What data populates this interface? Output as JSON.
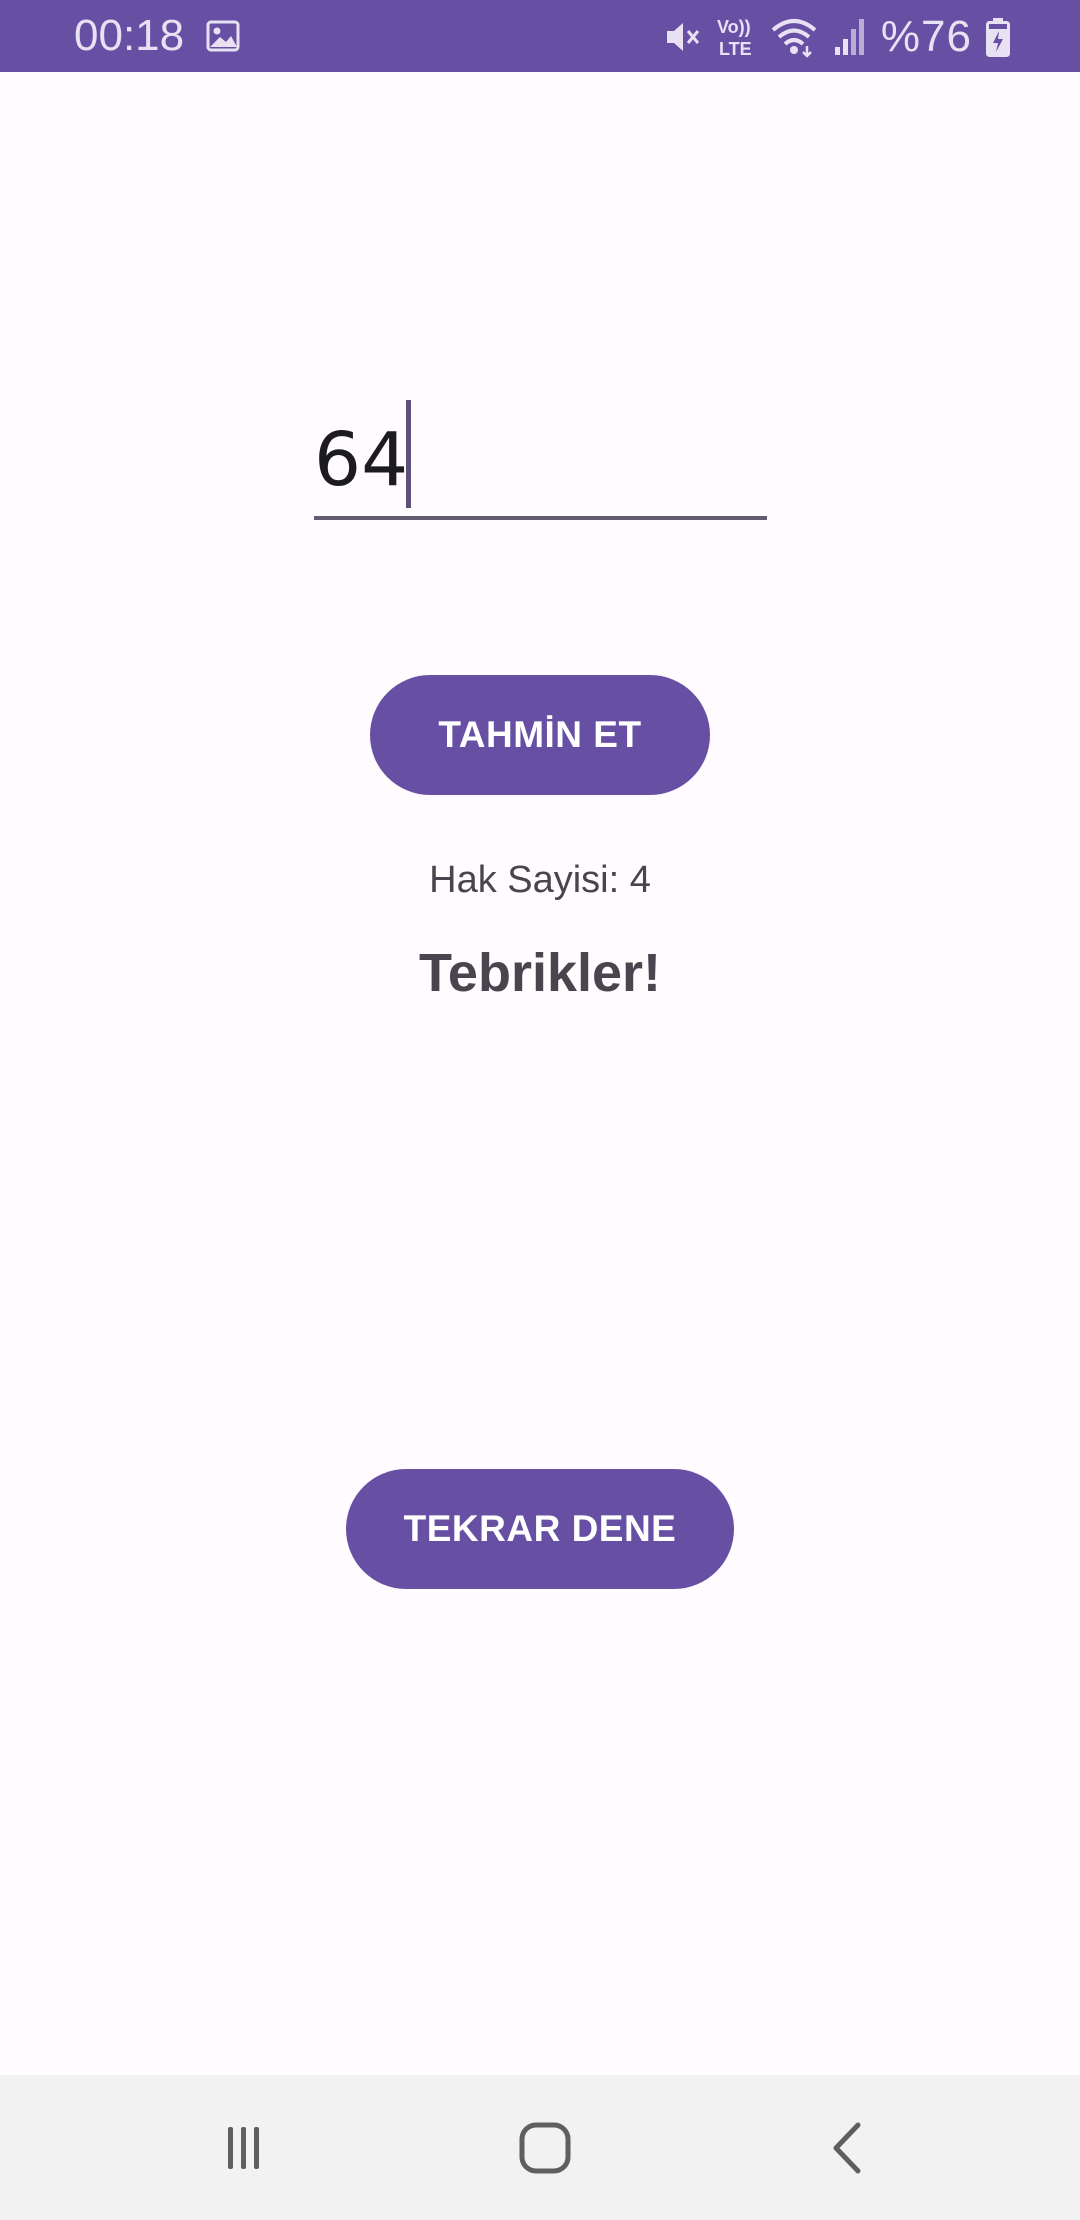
{
  "status_bar": {
    "time": "00:18",
    "battery": "%76",
    "icons": [
      "gallery-icon",
      "mute-icon",
      "volte-icon",
      "wifi-icon",
      "signal-icon",
      "battery-charging-icon"
    ],
    "volte_top": "Vo))",
    "volte_bottom": "LTE"
  },
  "guess": {
    "value": "64"
  },
  "buttons": {
    "guess_label": "TAHMİN ET",
    "retry_label": "TEKRAR DENE"
  },
  "attempts_text": "Hak Sayisi: 4",
  "result_text": "Tebrikler!",
  "navigation": {
    "icons": [
      "recent-apps-icon",
      "home-icon",
      "back-icon"
    ]
  },
  "colors": {
    "accent": "#6750a4",
    "background": "#fffbfe",
    "text": "#49454f",
    "nav_background": "#f2f2f2"
  }
}
